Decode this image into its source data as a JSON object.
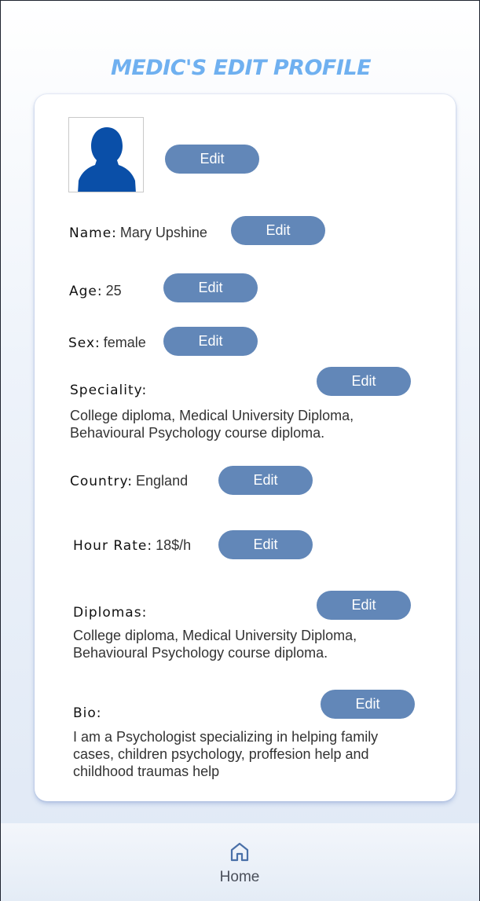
{
  "page": {
    "title": "Medic's Edit Profile"
  },
  "profile": {
    "edit_label": "Edit",
    "name": {
      "label": "Name:",
      "value": "Mary Upshine"
    },
    "age": {
      "label": "Age:",
      "value": "25"
    },
    "sex": {
      "label": "Sex:",
      "value": "female"
    },
    "speciality": {
      "label": "Speciality:",
      "value_line1": "College diploma, Medical University Diploma,",
      "value_line2": "Behavioural Psychology course diploma."
    },
    "country": {
      "label": "Country:",
      "value": "England"
    },
    "hour_rate": {
      "label": "Hour Rate:",
      "value": "18$/h"
    },
    "diplomas": {
      "label": "Diplomas:",
      "value_line1": "College diploma, Medical University Diploma,",
      "value_line2": "Behavioural Psychology course diploma."
    },
    "bio": {
      "label": "Bio:",
      "value_line1": "I am a Psychologist specializing in helping family",
      "value_line2": "cases, children psychology, proffesion help and",
      "value_line3": "childhood traumas help"
    }
  },
  "nav": {
    "home_label": "Home"
  },
  "colors": {
    "title": "#6fb0f0",
    "button": "#6287b8",
    "avatar_silhouette": "#0a4fa8"
  },
  "icons": {
    "avatar": "user-silhouette-icon",
    "home": "home-icon"
  }
}
